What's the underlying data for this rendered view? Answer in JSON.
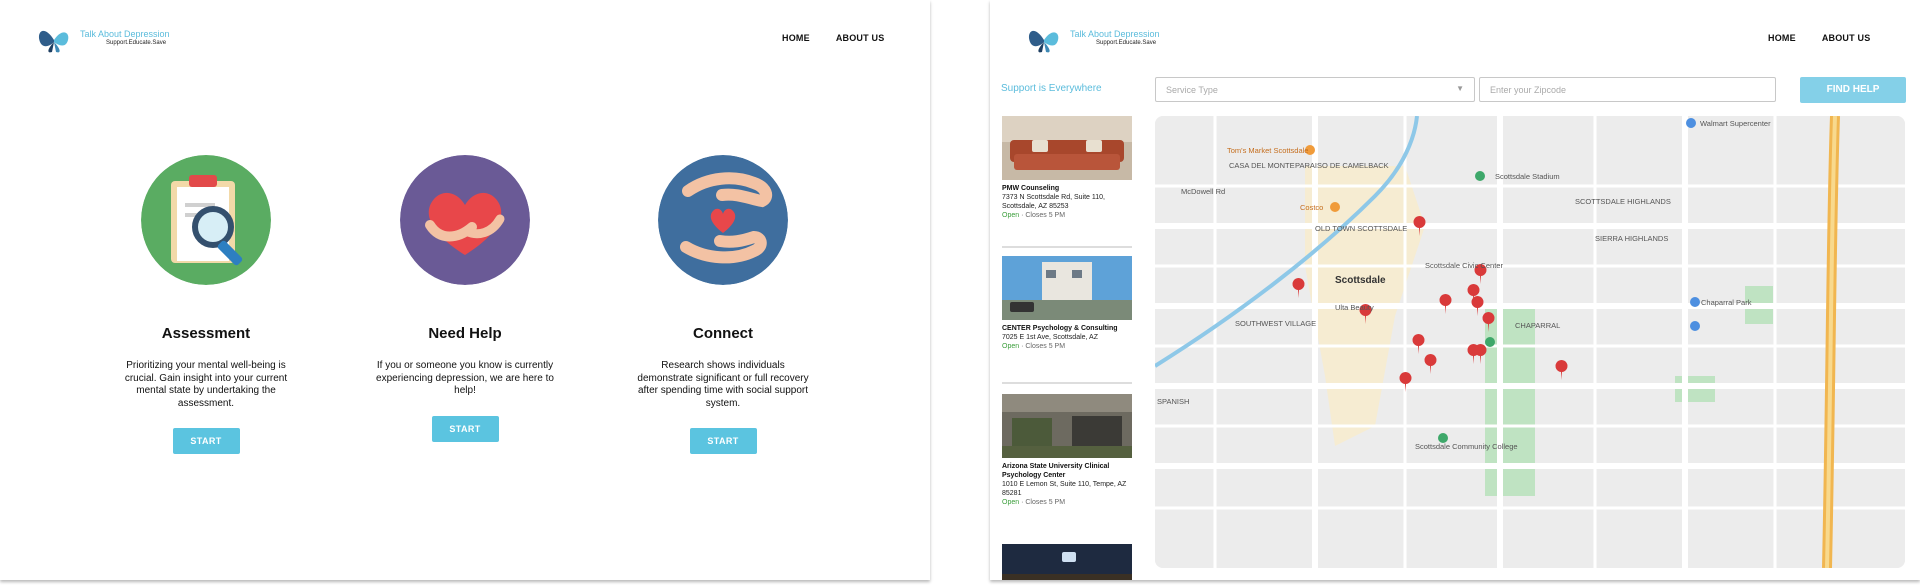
{
  "left_page": {
    "brand": {
      "title": "Talk About Depression",
      "tagline": "Support.Educate.Save"
    },
    "nav": {
      "home": "HOME",
      "about": "ABOUT US"
    },
    "cards": [
      {
        "title": "Assessment",
        "text": "Prioritizing your mental well-being is crucial. Gain insight into your current mental state by undertaking the assessment.",
        "button": "START",
        "icon": "clipboard-magnifier-icon",
        "color": "#5aac62"
      },
      {
        "title": "Need Help",
        "text": "If you or someone you know is currently experiencing depression, we are here to help!",
        "button": "START",
        "icon": "hugging-heart-icon",
        "color": "#6a5a96"
      },
      {
        "title": "Connect",
        "text": "Research shows individuals demonstrate significant or full recovery after spending time with social support system.",
        "button": "START",
        "icon": "hands-heart-icon",
        "color": "#3f6e9e"
      }
    ]
  },
  "right_page": {
    "brand": {
      "title": "Talk About Depression",
      "tagline": "Support.Educate.Save"
    },
    "nav": {
      "home": "HOME",
      "about": "ABOUT US"
    },
    "support_title": "Support is Everywhere",
    "service_select": {
      "placeholder": "Service Type"
    },
    "zip_input": {
      "placeholder": "Enter your Zipcode"
    },
    "find_button": "FIND HELP",
    "results": [
      {
        "name": "PMW Counseling",
        "address": "7373 N Scottsdale Rd, Suite 110, Scottsdale, AZ 85253",
        "status": "Open",
        "hours": "Closes 5 PM"
      },
      {
        "name": "CENTER Psychology & Consulting",
        "address": "7025 E 1st Ave, Scottsdale, AZ",
        "status": "Open",
        "hours": "Closes 5 PM"
      },
      {
        "name": "Arizona State University Clinical Psychology Center",
        "address": "1010 E Lemon St, Suite 110, Tempe, AZ 85281",
        "status": "Open",
        "hours": "Closes 5 PM"
      }
    ],
    "map": {
      "labels": {
        "walmart": "Walmart Supercenter",
        "tomasso": "Tom's Market Scottsdale",
        "casa_del_monte": "CASA DEL MONTE",
        "paseo": "PARAISO DE CAMELBACK",
        "costco": "Costco",
        "old_town": "OLD TOWN SCOTTSDALE",
        "scottsdale": "Scottsdale",
        "southwest": "SOUTHWEST VILLAGE",
        "spanish": "SPANISH",
        "highlands": "SCOTTSDALE HIGHLANDS",
        "sierra": "SIERRA HIGHLANDS",
        "chaparral": "CHAPARRAL",
        "trader": "Chaparral Park",
        "scottsdale_stadium": "Scottsdale Stadium",
        "civic": "Scottsdale Civic Center",
        "mckellips": "McDowell Rd",
        "ulta": "Ulta Beauty",
        "scottsdale_community": "Scottsdale Community College"
      }
    }
  }
}
